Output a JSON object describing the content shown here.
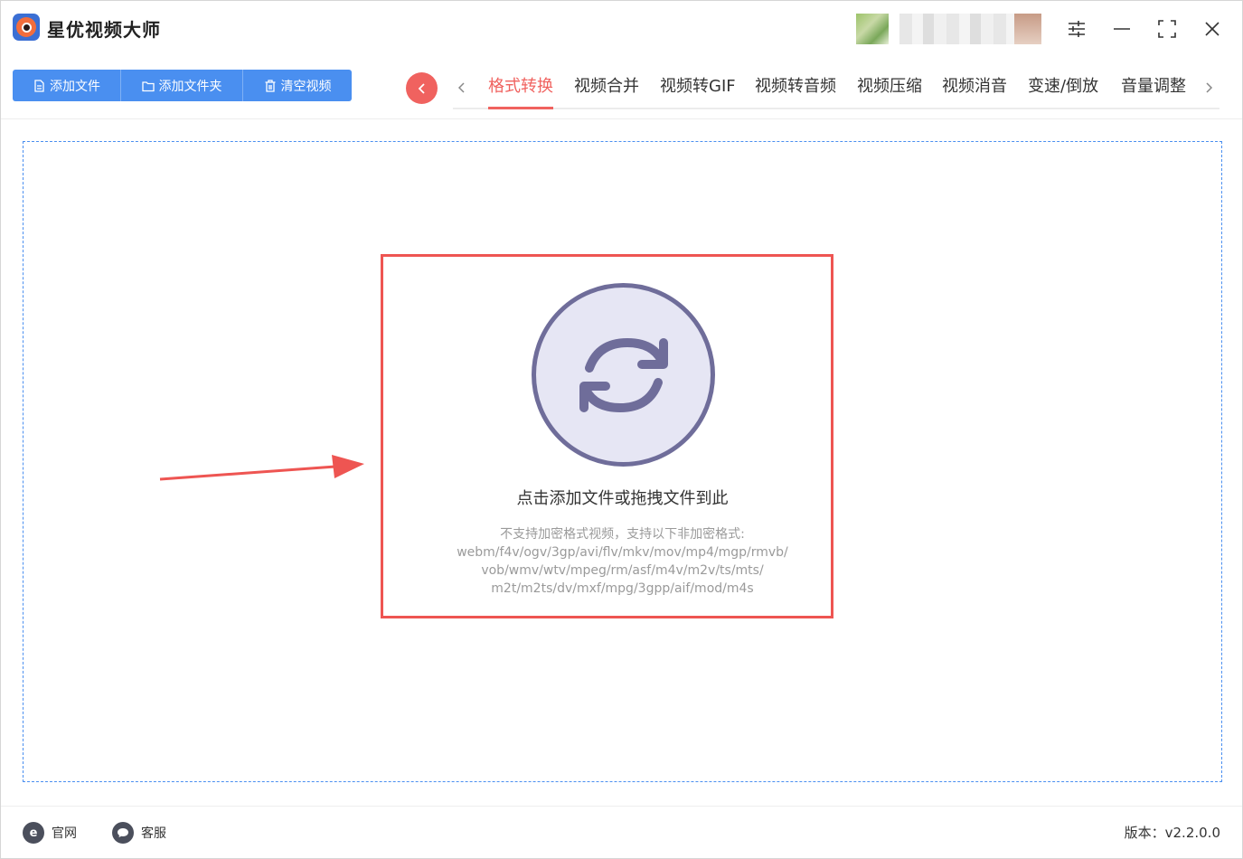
{
  "app": {
    "title": "星优视频大师"
  },
  "toolbar": {
    "add_file": "添加文件",
    "add_folder": "添加文件夹",
    "clear_videos": "清空视频"
  },
  "tabs": [
    {
      "label": "格式转换",
      "active": true
    },
    {
      "label": "视频合并"
    },
    {
      "label": "视频转GIF"
    },
    {
      "label": "视频转音频"
    },
    {
      "label": "视频压缩"
    },
    {
      "label": "视频消音"
    },
    {
      "label": "变速/倒放"
    },
    {
      "label": "音量调整"
    }
  ],
  "dropzone": {
    "hint": "点击添加文件或拖拽文件到此",
    "formats_line1": "不支持加密格式视频，支持以下非加密格式:",
    "formats_line2": "webm/f4v/ogv/3gp/avi/flv/mkv/mov/mp4/mgp/rmvb/",
    "formats_line3": "vob/wmv/wtv/mpeg/rm/asf/m4v/m2v/ts/mts/",
    "formats_line4": "m2t/m2ts/dv/mxf/mpg/3gpp/aif/mod/m4s"
  },
  "footer": {
    "website": "官网",
    "support": "客服",
    "version": "版本：v2.2.0.0"
  },
  "colors": {
    "accent_blue": "#4a8ff0",
    "accent_red": "#f0625f",
    "highlight_red": "#ee5552",
    "circle_fill": "#e6e6f4",
    "circle_stroke": "#6f6d9a"
  }
}
